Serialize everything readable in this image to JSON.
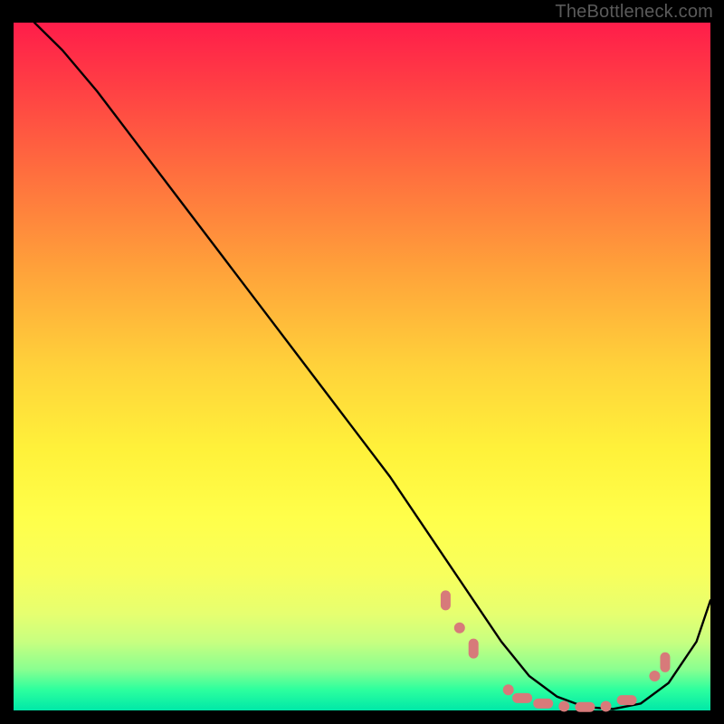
{
  "watermark": "TheBottleneck.com",
  "chart_data": {
    "type": "line",
    "title": "",
    "xlabel": "",
    "ylabel": "",
    "xlim": [
      0,
      100
    ],
    "ylim": [
      0,
      100
    ],
    "grid": false,
    "legend": false,
    "series": [
      {
        "name": "curve",
        "color": "#000000",
        "x": [
          3,
          7,
          12,
          18,
          24,
          30,
          36,
          42,
          48,
          54,
          58,
          62,
          66,
          70,
          74,
          78,
          82,
          86,
          90,
          94,
          98,
          100
        ],
        "y": [
          100,
          96,
          90,
          82,
          74,
          66,
          58,
          50,
          42,
          34,
          28,
          22,
          16,
          10,
          5,
          2,
          0.5,
          0.2,
          1,
          4,
          10,
          16
        ]
      }
    ],
    "markers": [
      {
        "x": 62,
        "y": 16,
        "shape": "capsule-v"
      },
      {
        "x": 64,
        "y": 12,
        "shape": "dot"
      },
      {
        "x": 66,
        "y": 9,
        "shape": "capsule-v"
      },
      {
        "x": 71,
        "y": 3,
        "shape": "dot"
      },
      {
        "x": 73,
        "y": 1.8,
        "shape": "capsule-h"
      },
      {
        "x": 76,
        "y": 1.0,
        "shape": "capsule-h"
      },
      {
        "x": 79,
        "y": 0.6,
        "shape": "dot"
      },
      {
        "x": 82,
        "y": 0.5,
        "shape": "capsule-h"
      },
      {
        "x": 85,
        "y": 0.6,
        "shape": "dot"
      },
      {
        "x": 88,
        "y": 1.5,
        "shape": "capsule-h"
      },
      {
        "x": 92,
        "y": 5,
        "shape": "dot"
      },
      {
        "x": 93.5,
        "y": 7,
        "shape": "capsule-v"
      }
    ],
    "marker_color": "#d77a7a"
  }
}
